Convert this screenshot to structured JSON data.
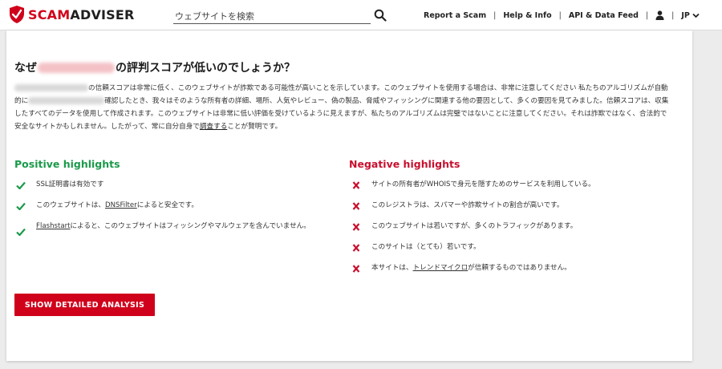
{
  "header": {
    "logo_text_1": "SCAM",
    "logo_text_2": "ADVISER",
    "search_placeholder": "ウェブサイトを検索",
    "nav": [
      "Report a Scam",
      "Help & Info",
      "API & Data Feed"
    ],
    "language": "JP",
    "separator": "|"
  },
  "main": {
    "heading_prefix": "なぜ",
    "heading_suffix": "の評判スコアが低いのでしょうか？",
    "desc_part1": "の信頼スコアは非常に低く、このウェブサイトが詐欺である可能性が高いことを示しています。このウェブサイトを使用する場合は、非常に注意してください 私たちのアルゴリズムが自動的に",
    "desc_part2": "確認したとき、我々はそのような所有者の詳細、場所、人気やレビュー、偽の製品、脅威やフィッシングに関連する他の要因として、多くの要因を見てみました。信頼スコアは、収集したすべてのデータを使用して作成されます。このウェブサイトは非常に低い評価を受けているように見えますが、私たちのアルゴリズムは完璧ではないことに注意してください。それは詐欺ではなく、合法的で安全なサイトかもしれません。したがって、常に自分自身で",
    "desc_link": "調査する",
    "desc_part3": "ことが賢明です。",
    "positive_title": "Positive highlights",
    "negative_title": "Negative highlights",
    "positive": [
      {
        "text": "SSL証明書は有効です"
      },
      {
        "pre": "このウェブサイトは、",
        "link": "DNSFilter",
        "post": "によると安全です。"
      },
      {
        "pre": "",
        "link": "Flashstart",
        "post": "によると、このウェブサイトはフィッシングやマルウェアを含んでいません。"
      }
    ],
    "negative": [
      {
        "text": "サイトの所有者がWHOISで身元を隠すためのサービスを利用している。"
      },
      {
        "text": "このレジストラは、スパマーや詐欺サイトの割合が高いです。"
      },
      {
        "text": "このウェブサイトは若いですが、多くのトラフィックがあります。"
      },
      {
        "text": "このサイトは（とても）若いです。"
      },
      {
        "pre": "本サイトは、",
        "link": "トレンドマイクロ",
        "post": "が信頼するものではありません。"
      }
    ],
    "analysis_button": "SHOW DETAILED ANALYSIS"
  },
  "colors": {
    "brand_red": "#d0021b",
    "positive_green": "#1a9a4a",
    "negative_red": "#c8102e"
  },
  "icons": {
    "positive": "check-icon",
    "negative": "x-icon",
    "user": "user-icon",
    "search": "search-icon"
  }
}
